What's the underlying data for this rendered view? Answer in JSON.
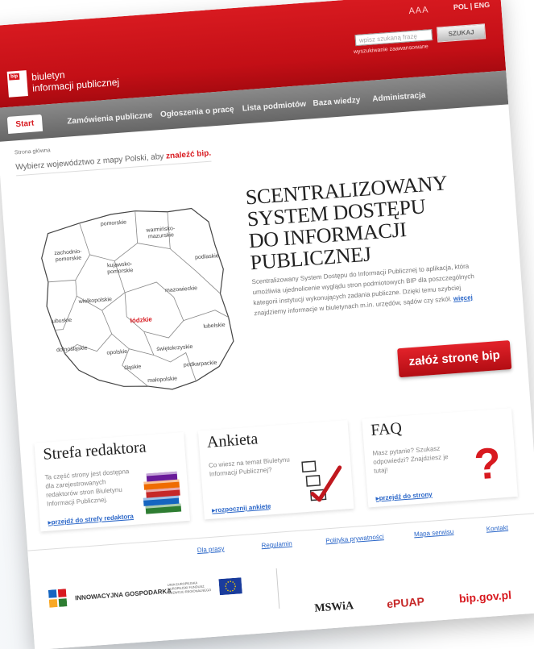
{
  "header": {
    "font_controls": "AAA",
    "lang_pol": "POL",
    "lang_sep": "|",
    "lang_eng": "ENG",
    "search_placeholder": "wpisz szukaną frazę",
    "advanced_search": "wyszukiwanie zaawansowane",
    "search_button": "SZUKAJ",
    "logo_badge": "bip",
    "logo_line1": "biuletyn",
    "logo_line2": "informacji publicznej"
  },
  "nav": {
    "start": "Start",
    "items": [
      "Zamówienia publiczne",
      "Ogłoszenia o pracę",
      "Lista podmiotów",
      "Baza wiedzy",
      "Administracja"
    ]
  },
  "breadcrumb": "Strona główna",
  "choose_text": "Wybierz województwo z mapy Polski, aby",
  "choose_link": "znaleźć bip.",
  "map": {
    "regions": [
      "pomorskie",
      "warmińsko-\nmazurskie",
      "zachodnio-\npomorskie",
      "kujawsko-\npomorskie",
      "podlaskie",
      "mazowieckie",
      "wielkopolskie",
      "lubuskie",
      "łódzkie",
      "lubelskie",
      "dolnośląskie",
      "opolskie",
      "świętokrzyskie",
      "śląskie",
      "podkarpackie",
      "małopolskie"
    ]
  },
  "hero": {
    "title_line1": "SCENTRALIZOWANY",
    "title_line2": "SYSTEM DOSTĘPU",
    "title_line3": "DO INFORMACJI",
    "title_line4": "PUBLICZNEJ",
    "description": "Scentralizowany System Dostępu do Informacji Publicznej to aplikacja, która umożliwia ujednolicenie wyglądu stron podmiotowych BIP dla poszczególnych kategorii instytucji wykonujących zadania publiczne. Dzięki temu szybciej znajdziemy informacje w biuletynach m.in. urzędów, sądów czy szkół.",
    "more_link": "więcej",
    "cta": "załóż stronę bip"
  },
  "boxes": {
    "editor": {
      "title": "Strefa redaktora",
      "text": "Ta część strony jest dostępna dla zarejestrowanych redaktorów stron Biuletynu Informacji Publicznej.",
      "link": "przejdź do strefy redaktora"
    },
    "survey": {
      "title": "Ankieta",
      "text": "Co wiesz na temat Biuletynu Informacji Publicznej?",
      "link": "rozpocznij ankietę"
    },
    "faq": {
      "title": "FAQ",
      "text": "Masz pytanie? Szukasz odpowiedzi? Znajdziesz je tutaj!",
      "link": "przejdź do strony"
    }
  },
  "footer": {
    "links": [
      "Dla prasy",
      "Regulamin",
      "Polityka prywatności",
      "Mapa serwisu",
      "Kontakt"
    ],
    "ig_logo_text": "INNOWACYJNA GOSPODARKA",
    "ue_text": "UNIA EUROPEJSKA EUROPEJSKI FUNDUSZ ROZWOJU REGIONALNEGO",
    "partner_mswia": "MSWiA",
    "partner_epuap": "ePUAP",
    "partner_bip": "bip.gov.pl"
  },
  "colors": {
    "brand_red": "#d81a20",
    "link_blue": "#2a66c8"
  }
}
